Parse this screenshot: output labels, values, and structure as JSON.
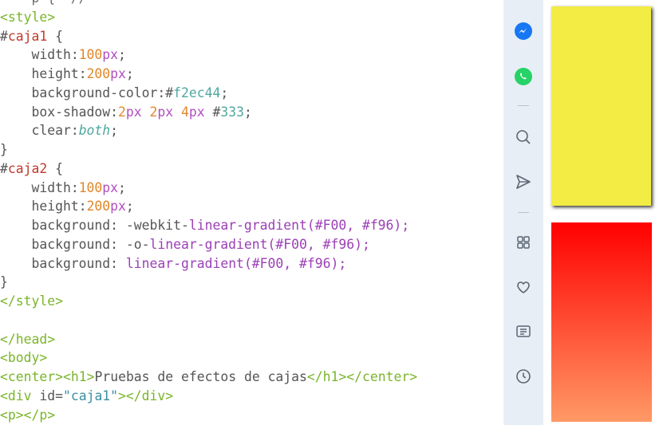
{
  "code": {
    "lines": [
      [
        {
          "t": "    ",
          "c": "pun"
        },
        {
          "t": "p ",
          "c": "pun"
        },
        {
          "t": "{",
          "c": "pun"
        },
        {
          "t": "  ",
          "c": "pun"
        },
        {
          "t": "/",
          "c": "pun"
        },
        {
          "t": "/",
          "c": "pun"
        }
      ],
      [
        {
          "t": "<",
          "c": "tag"
        },
        {
          "t": "style",
          "c": "tag"
        },
        {
          "t": ">",
          "c": "tag"
        }
      ],
      [
        {
          "t": "#",
          "c": "pun"
        },
        {
          "t": "caja1",
          "c": "sel"
        },
        {
          "t": " {",
          "c": "pun"
        }
      ],
      [
        {
          "t": "    width",
          "c": "attr"
        },
        {
          "t": ":",
          "c": "pun"
        },
        {
          "t": "100",
          "c": "num"
        },
        {
          "t": "px",
          "c": "unit"
        },
        {
          "t": ";",
          "c": "pun"
        }
      ],
      [
        {
          "t": "    height",
          "c": "attr"
        },
        {
          "t": ":",
          "c": "pun"
        },
        {
          "t": "200",
          "c": "num"
        },
        {
          "t": "px",
          "c": "unit"
        },
        {
          "t": ";",
          "c": "pun"
        }
      ],
      [
        {
          "t": "    background-color",
          "c": "attr"
        },
        {
          "t": ":",
          "c": "pun"
        },
        {
          "t": "#",
          "c": "pun"
        },
        {
          "t": "f2ec44",
          "c": "hex"
        },
        {
          "t": ";",
          "c": "pun"
        }
      ],
      [
        {
          "t": "    box-shadow",
          "c": "attr"
        },
        {
          "t": ":",
          "c": "pun"
        },
        {
          "t": "2",
          "c": "num"
        },
        {
          "t": "px",
          "c": "unit"
        },
        {
          "t": " ",
          "c": "pun"
        },
        {
          "t": "2",
          "c": "num"
        },
        {
          "t": "px",
          "c": "unit"
        },
        {
          "t": " ",
          "c": "pun"
        },
        {
          "t": "4",
          "c": "num"
        },
        {
          "t": "px",
          "c": "unit"
        },
        {
          "t": " #",
          "c": "pun"
        },
        {
          "t": "333",
          "c": "hex"
        },
        {
          "t": ";",
          "c": "pun"
        }
      ],
      [
        {
          "t": "    clear",
          "c": "attr"
        },
        {
          "t": ":",
          "c": "pun"
        },
        {
          "t": "both",
          "c": "kw"
        },
        {
          "t": ";",
          "c": "pun"
        }
      ],
      [
        {
          "t": "}",
          "c": "pun"
        }
      ],
      [
        {
          "t": "#",
          "c": "pun"
        },
        {
          "t": "caja2",
          "c": "sel"
        },
        {
          "t": " {",
          "c": "pun"
        }
      ],
      [
        {
          "t": "    width",
          "c": "attr"
        },
        {
          "t": ":",
          "c": "pun"
        },
        {
          "t": "100",
          "c": "num"
        },
        {
          "t": "px",
          "c": "unit"
        },
        {
          "t": ";",
          "c": "pun"
        }
      ],
      [
        {
          "t": "    height",
          "c": "attr"
        },
        {
          "t": ":",
          "c": "pun"
        },
        {
          "t": "200",
          "c": "num"
        },
        {
          "t": "px",
          "c": "unit"
        },
        {
          "t": ";",
          "c": "pun"
        }
      ],
      [
        {
          "t": "    background",
          "c": "attr"
        },
        {
          "t": ": -webkit-",
          "c": "pun"
        },
        {
          "t": "linear-gradient",
          "c": "fn"
        },
        {
          "t": "(#F00, #f96);",
          "c": "fn"
        }
      ],
      [
        {
          "t": "    background",
          "c": "attr"
        },
        {
          "t": ": -o-",
          "c": "pun"
        },
        {
          "t": "linear-gradient",
          "c": "fn"
        },
        {
          "t": "(#F00, #f96);",
          "c": "fn"
        }
      ],
      [
        {
          "t": "    background",
          "c": "attr"
        },
        {
          "t": ": ",
          "c": "pun"
        },
        {
          "t": "linear-gradient",
          "c": "fn"
        },
        {
          "t": "(#F00, #f96);",
          "c": "fn"
        }
      ],
      [
        {
          "t": "}",
          "c": "pun"
        }
      ],
      [
        {
          "t": "</",
          "c": "tag"
        },
        {
          "t": "style",
          "c": "tag"
        },
        {
          "t": ">",
          "c": "tag"
        }
      ],
      [
        {
          "t": "",
          "c": "pun"
        }
      ],
      [
        {
          "t": "</",
          "c": "tag"
        },
        {
          "t": "head",
          "c": "tag"
        },
        {
          "t": ">",
          "c": "tag"
        }
      ],
      [
        {
          "t": "<",
          "c": "tag"
        },
        {
          "t": "body",
          "c": "tag"
        },
        {
          "t": ">",
          "c": "tag"
        }
      ],
      [
        {
          "t": "<",
          "c": "tag"
        },
        {
          "t": "center",
          "c": "tag"
        },
        {
          "t": ">",
          "c": "tag"
        },
        {
          "t": "<",
          "c": "tag"
        },
        {
          "t": "h1",
          "c": "tag"
        },
        {
          "t": ">",
          "c": "tag"
        },
        {
          "t": "Pruebas de efectos de cajas",
          "c": "pun"
        },
        {
          "t": "</",
          "c": "tag"
        },
        {
          "t": "h1",
          "c": "tag"
        },
        {
          "t": ">",
          "c": "tag"
        },
        {
          "t": "</",
          "c": "tag"
        },
        {
          "t": "center",
          "c": "tag"
        },
        {
          "t": ">",
          "c": "tag"
        }
      ],
      [
        {
          "t": "<",
          "c": "tag"
        },
        {
          "t": "div",
          "c": "tag"
        },
        {
          "t": " id=",
          "c": "attr"
        },
        {
          "t": "\"caja1\"",
          "c": "str"
        },
        {
          "t": ">",
          "c": "tag"
        },
        {
          "t": "</",
          "c": "tag"
        },
        {
          "t": "div",
          "c": "tag"
        },
        {
          "t": ">",
          "c": "tag"
        }
      ],
      [
        {
          "t": "<",
          "c": "tag"
        },
        {
          "t": "p",
          "c": "tag"
        },
        {
          "t": ">",
          "c": "tag"
        },
        {
          "t": "</",
          "c": "tag"
        },
        {
          "t": "p",
          "c": "tag"
        },
        {
          "t": ">",
          "c": "tag"
        }
      ],
      [
        {
          "t": "<",
          "c": "tag"
        },
        {
          "t": "div",
          "c": "tag"
        },
        {
          "t": " id=",
          "c": "attr"
        },
        {
          "t": "\"caja2\"",
          "c": "str"
        },
        {
          "t": ">",
          "c": "tag"
        },
        {
          "t": "</",
          "c": "tag"
        },
        {
          "t": "div",
          "c": "tag"
        },
        {
          "t": ">",
          "c": "tag"
        }
      ]
    ]
  },
  "sidebar": {
    "icons": [
      {
        "name": "messenger-icon",
        "color": "#1877f2"
      },
      {
        "name": "whatsapp-icon",
        "color": "#25d366"
      },
      {
        "name": "search-icon",
        "color": "#5b6673"
      },
      {
        "name": "send-icon",
        "color": "#5b6673"
      },
      {
        "name": "apps-grid-icon",
        "color": "#5b6673"
      },
      {
        "name": "heart-icon",
        "color": "#5b6673"
      },
      {
        "name": "news-icon",
        "color": "#5b6673"
      },
      {
        "name": "history-clock-icon",
        "color": "#5b6673"
      }
    ]
  },
  "preview": {
    "caja1_color": "#f2ec44",
    "caja2_gradient_start": "#F00",
    "caja2_gradient_end": "#f96"
  }
}
